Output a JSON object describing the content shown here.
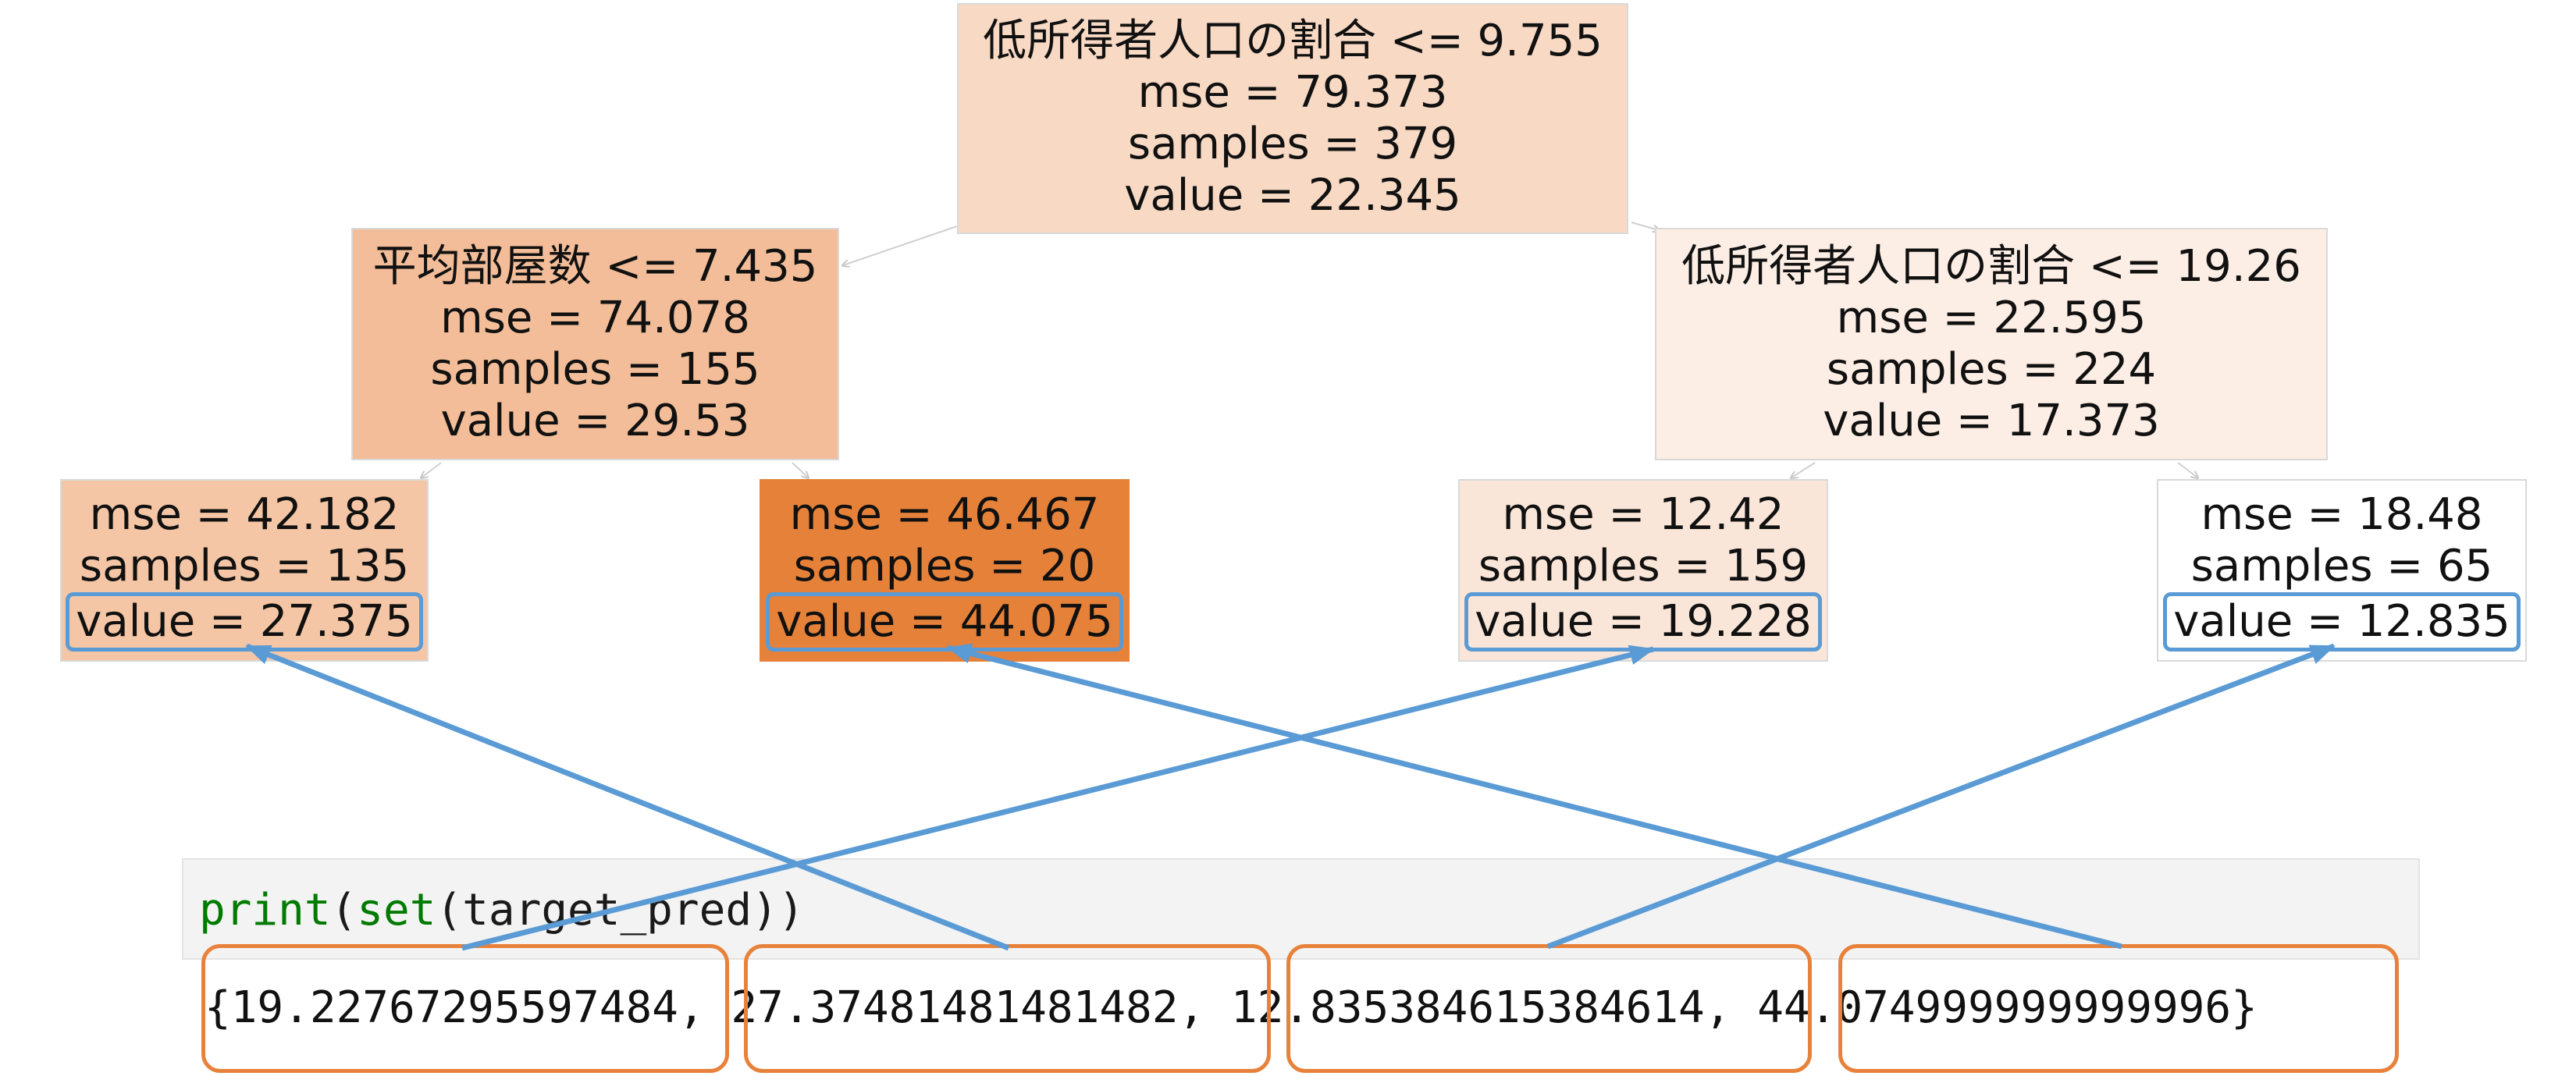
{
  "colors": {
    "highlight_box": "#5b9bd5",
    "arrow": "#5b9bd5",
    "output_box": "#e8823a",
    "code_function": "#007a00"
  },
  "tree": {
    "root": {
      "condition": "低所得者人口の割合 <= 9.755",
      "mse": "mse = 79.373",
      "samples": "samples = 379",
      "value": "value = 22.345",
      "fill": "#f7d9c4"
    },
    "left": {
      "condition": "平均部屋数 <= 7.435",
      "mse": "mse = 74.078",
      "samples": "samples = 155",
      "value": "value = 29.53",
      "fill": "#f2bd98"
    },
    "right": {
      "condition": "低所得者人口の割合 <= 19.26",
      "mse": "mse = 22.595",
      "samples": "samples = 224",
      "value": "value = 17.373",
      "fill": "#fceee5"
    },
    "leaf_ll": {
      "mse": "mse = 42.182",
      "samples": "samples = 135",
      "value": "value = 27.375",
      "fill": "#f4c6a5"
    },
    "leaf_lr": {
      "mse": "mse = 46.467",
      "samples": "samples = 20",
      "value": "value = 44.075",
      "fill": "#e58139"
    },
    "leaf_rl": {
      "mse": "mse = 12.42",
      "samples": "samples = 159",
      "value": "value = 19.228",
      "fill": "#fae6d8"
    },
    "leaf_rr": {
      "mse": "mse = 18.48",
      "samples": "samples = 65",
      "value": "value = 12.835",
      "fill": "#ffffff"
    }
  },
  "code": {
    "fn_print": "print",
    "paren_open": "(",
    "fn_set": "set",
    "arg": "(target_pred))"
  },
  "output": {
    "open_brace": "{",
    "v1": "19.22767295597484",
    "sep1": ", ",
    "v2": "27.37481481481482",
    "sep2": ", ",
    "v3": "12.835384615384614",
    "sep3": ", ",
    "v4": "44.074999999999996",
    "close_brace": "}"
  }
}
